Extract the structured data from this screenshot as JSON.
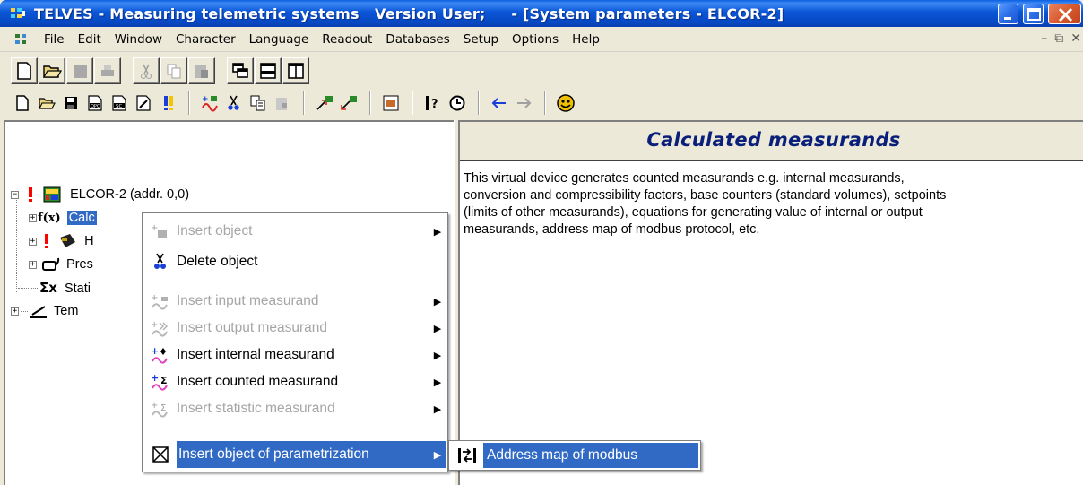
{
  "window": {
    "title": "TELVES - Measuring telemetric systems   Version User;     - [System parameters - ELCOR-2]"
  },
  "menubar": {
    "items": [
      "File",
      "Edit",
      "Window",
      "Character",
      "Language",
      "Readout",
      "Databases",
      "Setup",
      "Options",
      "Help"
    ]
  },
  "tree": {
    "root_label": "ELCOR-2 (addr. 0,0)",
    "selected_label": "Calc",
    "partial_labels": [
      "H",
      "Pres",
      "Stati",
      "Tem"
    ]
  },
  "right_panel": {
    "header": "Calculated measurands",
    "description_lines": [
      "This virtual device generates counted measurands e.g. internal measurands,",
      "conversion and compressibility factors, base counters (standard volumes), setpoints",
      "(limits of other measurands), equations for generating value of internal or output",
      "measurands, address map of modbus protocol, etc."
    ]
  },
  "context_menu": {
    "items": [
      {
        "label": "Insert object",
        "icon": "insert-object-icon",
        "disabled": true,
        "submenu": true
      },
      {
        "label": "Delete object",
        "icon": "scissors-icon",
        "disabled": false,
        "submenu": false
      },
      {
        "label": "Insert input measurand",
        "icon": "input-measurand-icon",
        "disabled": true,
        "submenu": true
      },
      {
        "label": "Insert output measurand",
        "icon": "output-measurand-icon",
        "disabled": true,
        "submenu": true
      },
      {
        "label": "Insert internal measurand",
        "icon": "internal-measurand-icon",
        "disabled": false,
        "submenu": true
      },
      {
        "label": "Insert counted measurand",
        "icon": "counted-measurand-icon",
        "disabled": false,
        "submenu": true
      },
      {
        "label": "Insert statistic measurand",
        "icon": "statistic-measurand-icon",
        "disabled": true,
        "submenu": true
      },
      {
        "label": "Insert object of parametrization",
        "icon": "parametrization-icon",
        "disabled": false,
        "submenu": true,
        "selected": true
      }
    ]
  },
  "submenu": {
    "items": [
      {
        "label": "Address map of modbus",
        "icon": "modbus-map-icon",
        "selected": true
      }
    ]
  },
  "colors": {
    "title_blue": "#0a55d6",
    "selection": "#316ac5",
    "header_text": "#0a1f7a",
    "warning_red": "#ff0000"
  }
}
